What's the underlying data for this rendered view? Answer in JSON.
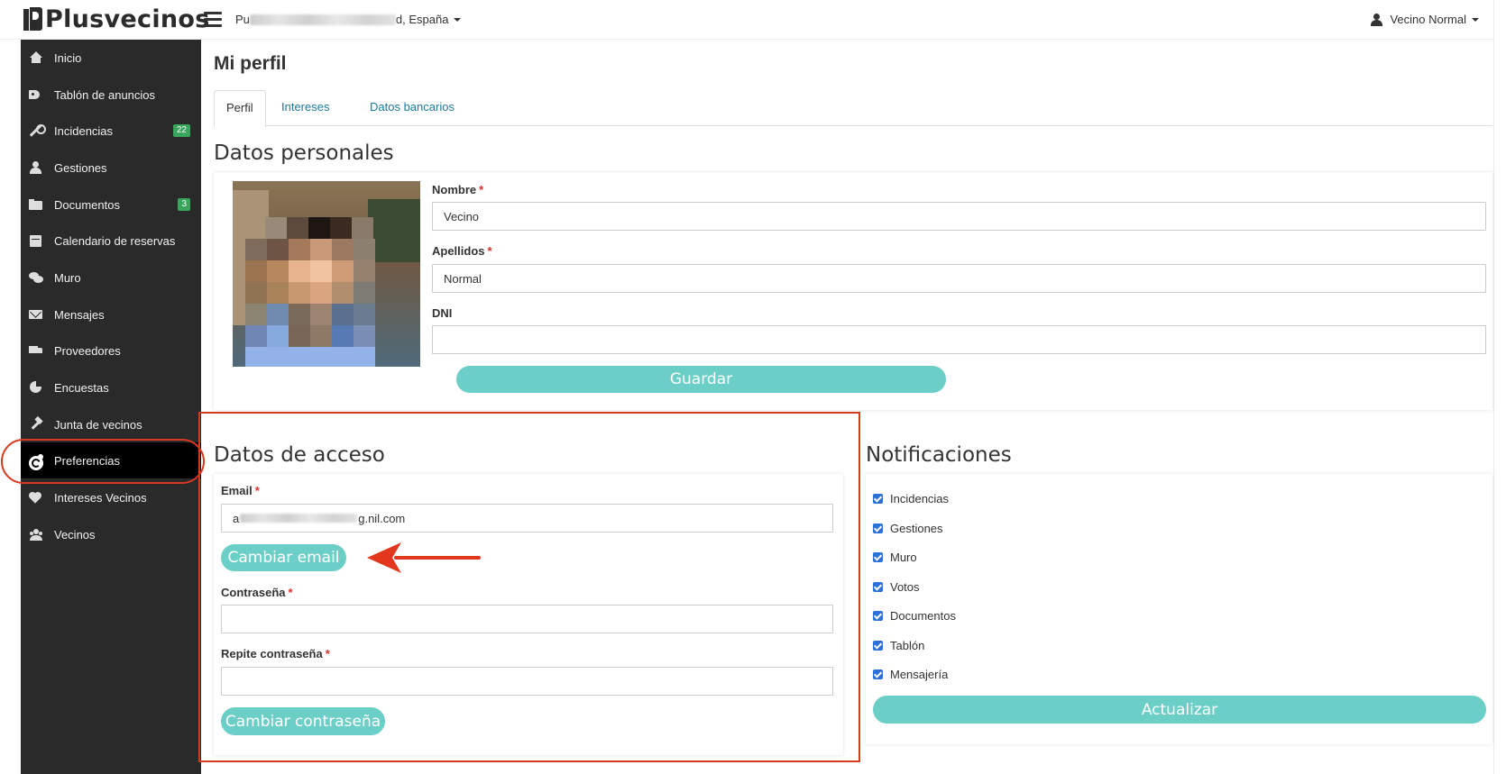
{
  "app": {
    "logo_text": "Plusvecinos"
  },
  "header": {
    "location_prefix": "Pu",
    "location_suffix": "d, España",
    "user_name": "Vecino Normal"
  },
  "sidebar": {
    "items": [
      {
        "label": "Inicio",
        "icon": "home-icon"
      },
      {
        "label": "Tablón de anuncios",
        "icon": "tags-icon"
      },
      {
        "label": "Incidencias",
        "icon": "wrench-icon",
        "badge": "22"
      },
      {
        "label": "Gestiones",
        "icon": "user-tie-icon"
      },
      {
        "label": "Documentos",
        "icon": "folder-open-icon",
        "badge": "3"
      },
      {
        "label": "Calendario de reservas",
        "icon": "calendar-icon"
      },
      {
        "label": "Muro",
        "icon": "comments-icon"
      },
      {
        "label": "Mensajes",
        "icon": "envelope-icon"
      },
      {
        "label": "Proveedores",
        "icon": "truck-icon"
      },
      {
        "label": "Encuestas",
        "icon": "pie-chart-icon"
      },
      {
        "label": "Junta de vecinos",
        "icon": "gavel-icon"
      },
      {
        "label": "Preferencias",
        "icon": "cogs-icon",
        "active": true
      },
      {
        "label": "Intereses Vecinos",
        "icon": "heart-icon"
      },
      {
        "label": "Vecinos",
        "icon": "users-icon"
      }
    ]
  },
  "page": {
    "title": "Mi perfil",
    "tabs": [
      {
        "label": "Perfil",
        "active": true
      },
      {
        "label": "Intereses"
      },
      {
        "label": "Datos bancarios"
      }
    ]
  },
  "personal": {
    "section_title": "Datos personales",
    "nombre_label": "Nombre",
    "nombre_value": "Vecino",
    "apellidos_label": "Apellidos",
    "apellidos_value": "Normal",
    "dni_label": "DNI",
    "dni_value": "",
    "required_mark": "*",
    "save_button": "Guardar"
  },
  "access": {
    "section_title": "Datos de acceso",
    "email_label": "Email",
    "email_value_prefix": "a",
    "email_value_suffix": "g.nil.com",
    "change_email_button": "Cambiar email",
    "password_label": "Contraseña",
    "repeat_password_label": "Repite contraseña",
    "change_password_button": "Cambiar contraseña"
  },
  "notifications": {
    "section_title": "Notificaciones",
    "options": [
      {
        "label": "Incidencias",
        "checked": true
      },
      {
        "label": "Gestiones",
        "checked": true
      },
      {
        "label": "Muro",
        "checked": true
      },
      {
        "label": "Votos",
        "checked": true
      },
      {
        "label": "Documentos",
        "checked": true
      },
      {
        "label": "Tablón",
        "checked": true
      },
      {
        "label": "Mensajería",
        "checked": true
      }
    ],
    "update_button": "Actualizar"
  },
  "colors": {
    "accent": "#6ccfc7",
    "sidebar_bg": "#2a2a2a",
    "badge_green": "#3aa55d",
    "annotation_red": "#d7391e",
    "link_blue": "#1b7a9a",
    "checkbox_blue": "#2a72d8"
  }
}
